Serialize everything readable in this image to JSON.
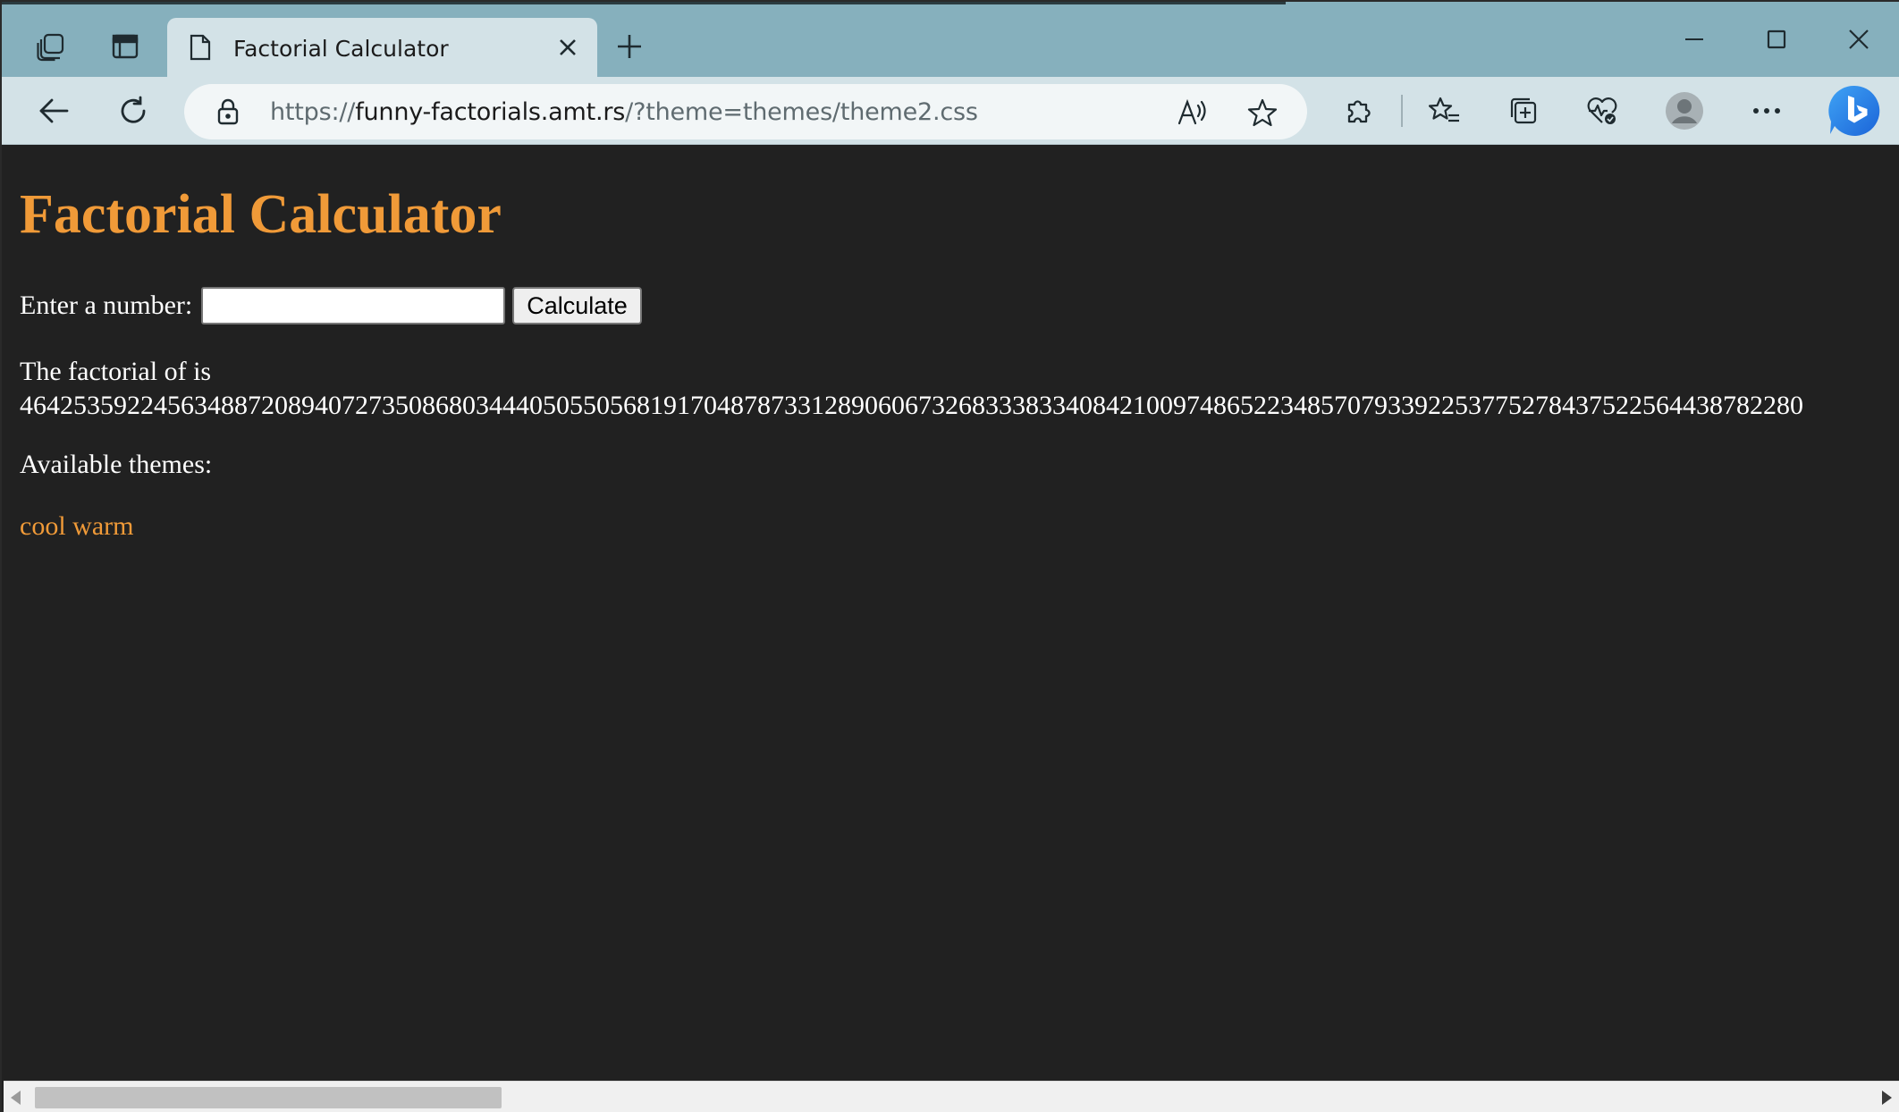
{
  "browser": {
    "tab": {
      "title": "Factorial Calculator"
    },
    "address": {
      "scheme": "https://",
      "host": "funny-factorials.amt.rs",
      "path": "/?theme=themes/theme2.css"
    }
  },
  "page": {
    "heading": "Factorial Calculator",
    "form": {
      "label": "Enter a number:",
      "input_value": "",
      "button_label": "Calculate"
    },
    "result_text": "The factorial of is",
    "result_value": "4642535922456348872089407273508680344405055056819170487873312890606732683338334084210097486522348570793392253775278437522564438782280",
    "themes_label": "Available themes:",
    "themes": [
      "cool",
      "warm"
    ]
  },
  "colors": {
    "accent": "#f09a38",
    "page_background": "#212121",
    "chrome": "#86b0bd",
    "toolbar": "#d3e2e7"
  }
}
